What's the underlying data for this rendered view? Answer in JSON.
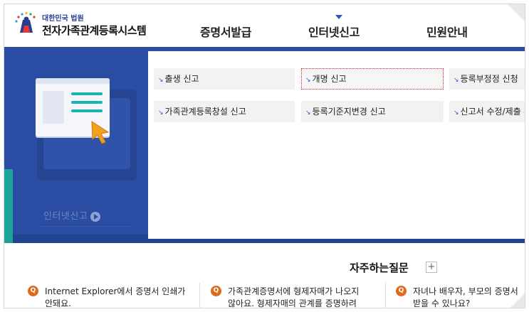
{
  "header": {
    "org_name": "대한민국 법원",
    "system_name": "전자가족관계등록시스템",
    "nav": [
      "증명서발급",
      "인터넷신고",
      "민원안내"
    ]
  },
  "banner": {
    "hint_label": "인터넷신고"
  },
  "menu": {
    "items": [
      {
        "label": "출생 신고"
      },
      {
        "label": "개명 신고"
      },
      {
        "label": "등록부정정 신청"
      },
      {
        "label": "가족관계등록창설 신고"
      },
      {
        "label": "등록기준지변경 신고"
      },
      {
        "label": "신고서 수정/제출"
      }
    ],
    "arrow_glyph": "↘"
  },
  "faq": {
    "title": "자주하는질문",
    "plus": "+",
    "icon_letter": "Q",
    "items": [
      {
        "line1": "Internet Explorer에서 증명서 인쇄가",
        "line2": "안돼요."
      },
      {
        "line1": "가족관계증명서에 형제자매가 나오지",
        "line2": "않아요. 형제자매의 관계를 증명하려"
      },
      {
        "line1": "자녀나 배우자, 부모의 증명서",
        "line2": "받을 수 있나요?"
      }
    ]
  },
  "colors": {
    "band_blue": "#2b4ca3",
    "teal": "#1ba39a",
    "faq_icon_orange": "#e06a1a",
    "focus_red": "#d9232e"
  }
}
